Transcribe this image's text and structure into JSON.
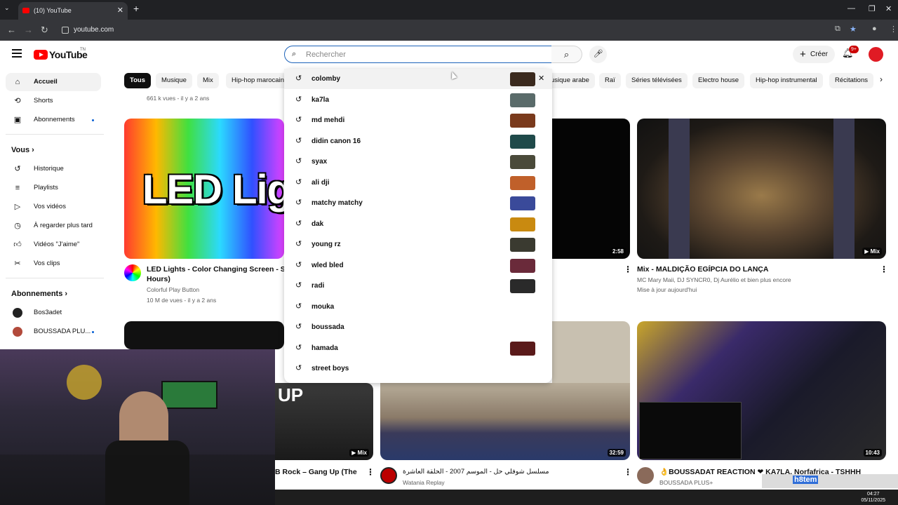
{
  "browser": {
    "tab_title": "(10) YouTube",
    "url": "youtube.com"
  },
  "header": {
    "logo_text": "YouTube",
    "logo_country": "TN",
    "search_placeholder": "Rechercher",
    "create_label": "Créer",
    "notification_count": "9+"
  },
  "sidebar": {
    "items": [
      {
        "label": "Accueil",
        "icon": "home-icon"
      },
      {
        "label": "Shorts",
        "icon": "shorts-icon"
      },
      {
        "label": "Abonnements",
        "icon": "subscriptions-icon"
      }
    ],
    "you_heading": "Vous",
    "you_items": [
      {
        "label": "Historique",
        "icon": "history-icon"
      },
      {
        "label": "Playlists",
        "icon": "playlists-icon"
      },
      {
        "label": "Vos vidéos",
        "icon": "your-videos-icon"
      },
      {
        "label": "À regarder plus tard",
        "icon": "watch-later-icon"
      },
      {
        "label": "Vidéos \"J'aime\"",
        "icon": "liked-icon"
      },
      {
        "label": "Vos clips",
        "icon": "clips-icon"
      }
    ],
    "subs_heading": "Abonnements",
    "subs": [
      {
        "label": "Bos3adet",
        "color": "#222222"
      },
      {
        "label": "BOUSSADA PLU...",
        "color": "#b24a3b"
      }
    ]
  },
  "chips": [
    "Tous",
    "Musique",
    "Mix",
    "Hip-hop marocain",
    "usique arabe",
    "Raï",
    "Séries télévisées",
    "Electro house",
    "Hip-hop instrumental",
    "Récitations"
  ],
  "top_meta": "661 k vues - il y a 2 ans",
  "videos": [
    {
      "title_line1": "LED Lights - Color Changing Screen - Slo",
      "title_line2": "Hours)",
      "channel": "Colorful Play Button",
      "meta": "10 M de vues - il y a 2 ans"
    },
    {
      "duration": "2:58"
    },
    {
      "title": "Mix - MALDIÇÃO EGÍPCIA DO LANÇA",
      "channel": "MC Mary Maii, DJ SYNCR0, Dj Aurélio et bien plus encore",
      "meta": "Mise à jour aujourd'hui",
      "badge": "Mix"
    },
    {
      "title": "B Rock – Gang Up (The",
      "badge": "Mix"
    },
    {
      "title": "مسلسل شوفلي حل - الموسم 2007 - الحلقة العاشرة",
      "channel": "Watania Replay",
      "duration": "32:59"
    },
    {
      "title": "👌BOUSSADAT REACTION ❤ KA7LA, Norfafrica - TSHHH",
      "channel": "BOUSSADA PLUS+",
      "duration": "10:43"
    }
  ],
  "thumb_texts": {
    "led": "LED Lig",
    "up": "UP"
  },
  "suggestions": [
    {
      "text": "colomby",
      "thumb": "#3b2a1e"
    },
    {
      "text": "ka7la",
      "thumb": "#5a6b6a"
    },
    {
      "text": "md mehdi",
      "thumb": "#7a3a1c"
    },
    {
      "text": "didin canon 16",
      "thumb": "#1f4a4a"
    },
    {
      "text": "syax",
      "thumb": "#4a4a3a"
    },
    {
      "text": "ali dji",
      "thumb": "#c0602a"
    },
    {
      "text": "matchy matchy",
      "thumb": "#3a4a9a"
    },
    {
      "text": "dak",
      "thumb": "#c98a10"
    },
    {
      "text": "young rz",
      "thumb": "#3a3a30"
    },
    {
      "text": "wled bled",
      "thumb": "#6a2a3a"
    },
    {
      "text": "radi",
      "thumb": "#2a2a2a"
    },
    {
      "text": "mouka",
      "thumb": null
    },
    {
      "text": "boussada",
      "thumb": null
    },
    {
      "text": "hamada",
      "thumb": "#5a1a1a"
    },
    {
      "text": "street boys",
      "thumb": null
    }
  ],
  "taskbar": {
    "tray_label": "h8tem",
    "time": "04:27",
    "date": "05/11/2025"
  }
}
